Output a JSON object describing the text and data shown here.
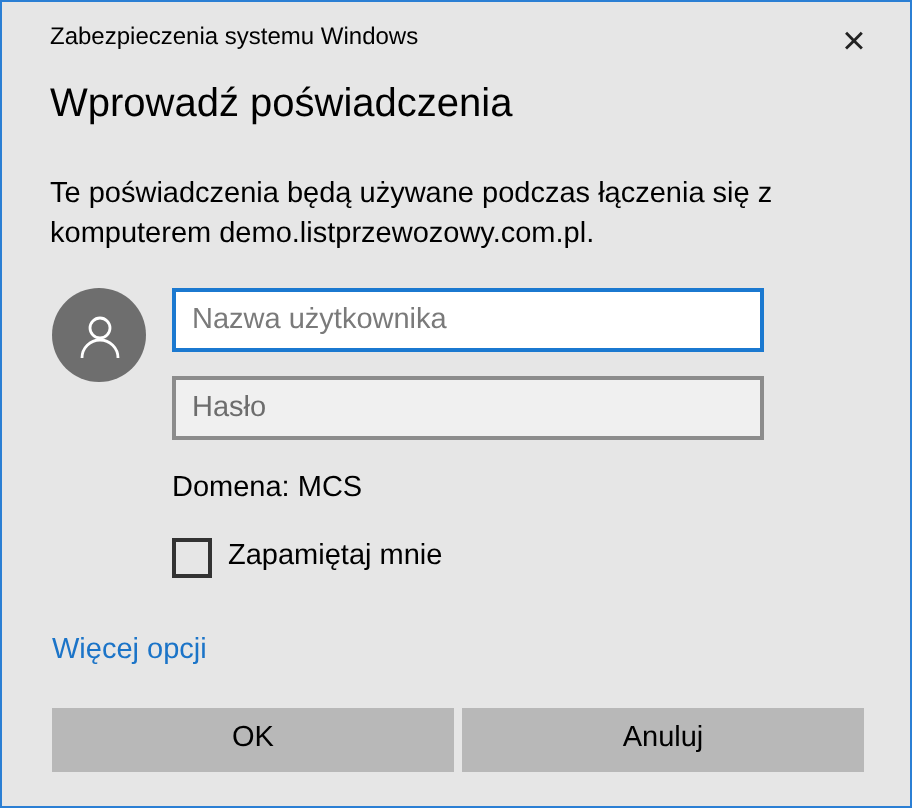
{
  "window": {
    "title": "Zabezpieczenia systemu Windows",
    "close": "×"
  },
  "heading": "Wprowadź poświadczenia",
  "description": "Te poświadczenia będą używane podczas łączenia się z komputerem demo.listprzewozowy.com.pl.",
  "fields": [
    {
      "placeholder": "Nazwa użytkownika",
      "focused": true
    },
    {
      "placeholder": "Hasło",
      "focused": false
    }
  ],
  "domain": "Domena: MCS",
  "remember": {
    "label": "Zapamiętaj mnie",
    "checked": false
  },
  "more_options": "Więcej opcji",
  "buttons": [
    "OK",
    "Anuluj"
  ]
}
